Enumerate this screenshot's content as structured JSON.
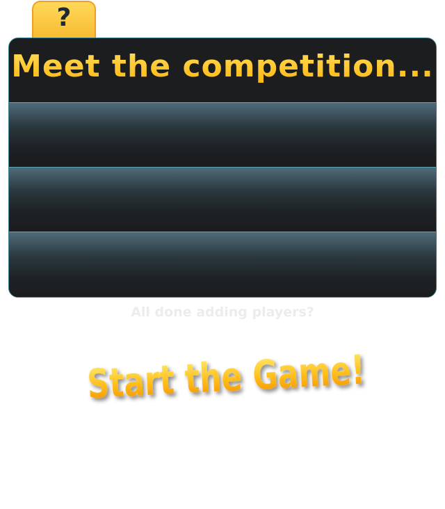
{
  "help_tab": {
    "label": "?"
  },
  "board": {
    "title": "Meet the competition...",
    "player_slots": [
      "",
      "",
      ""
    ]
  },
  "prompt": "All done adding players?",
  "start_button": {
    "label": "Start the Game!"
  },
  "colors": {
    "accent_gold": "#ffc21a",
    "panel_dark": "#1c1d1f",
    "panel_border": "#3a7d90",
    "slot_highlight": "#4f6b79"
  }
}
